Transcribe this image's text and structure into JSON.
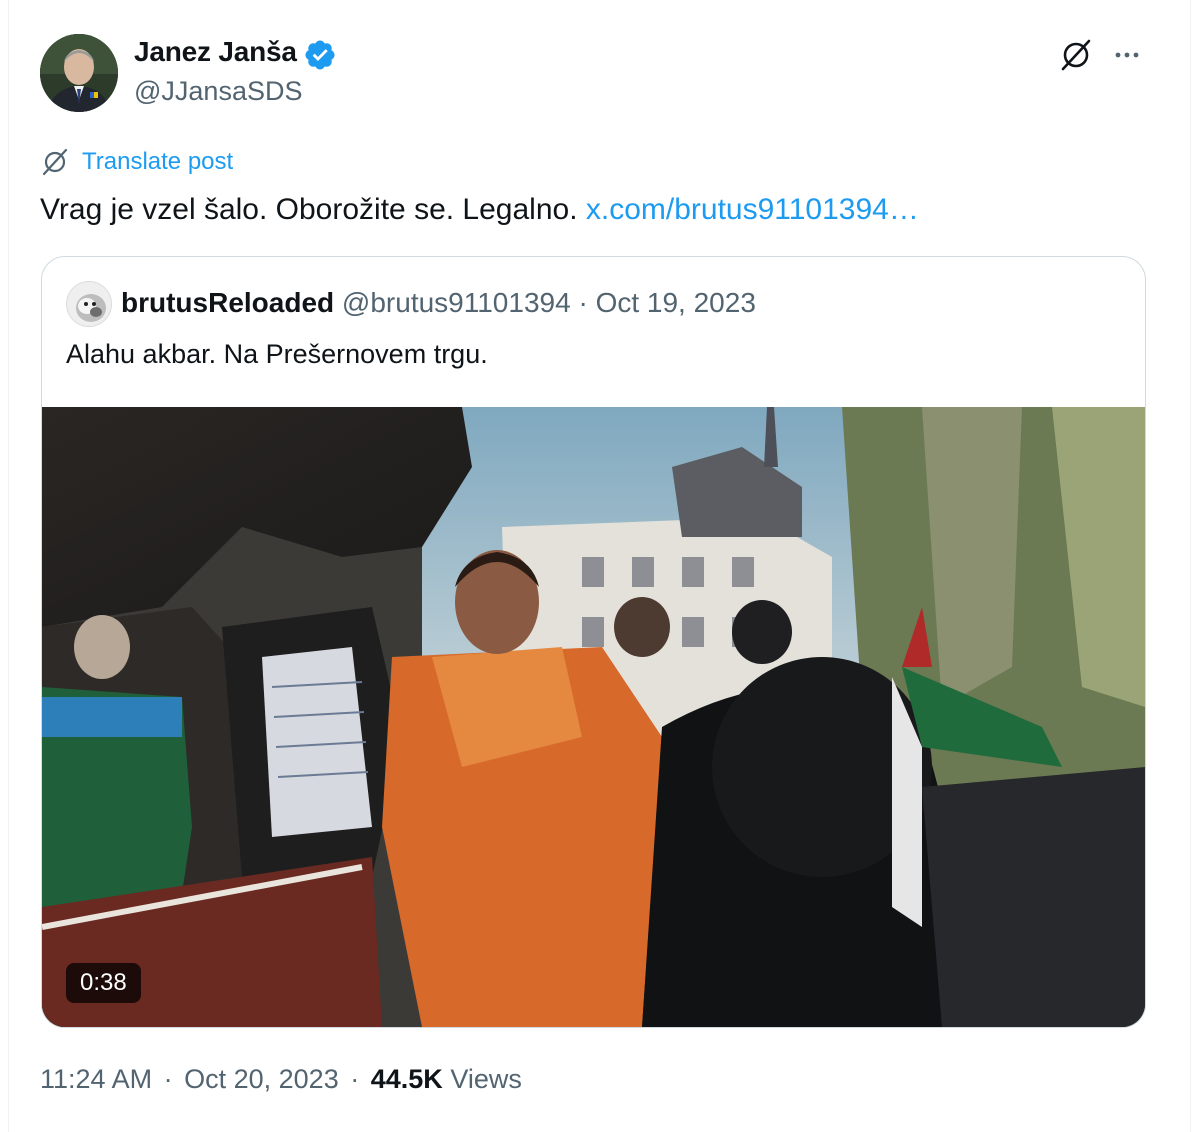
{
  "post": {
    "author": {
      "name": "Janez Janša",
      "handle": "@JJansaSDS",
      "verified_icon": "verified-badge-icon"
    },
    "actions": {
      "grok_icon": "grok-icon",
      "more_icon": "more-options-icon"
    },
    "translate_label": "Translate post",
    "text": "Vrag je vzel šalo. Oborožite se. Legalno.",
    "link_text": "x.com/brutus91101394…",
    "meta": {
      "time": "11:24 AM",
      "separator": "·",
      "date": "Oct 20, 2023",
      "views_count": "44.5K",
      "views_label": "Views"
    }
  },
  "quote": {
    "author_name": "brutusReloaded",
    "author_handle": "@brutus91101394",
    "separator": "·",
    "date": "Oct 19, 2023",
    "text": "Alahu akbar. Na Prešernovem trgu.",
    "video_duration": "0:38"
  },
  "colors": {
    "accent": "#1d9bf0",
    "secondary_text": "#536471",
    "primary_text": "#0f1419",
    "border": "#cfd9de"
  }
}
